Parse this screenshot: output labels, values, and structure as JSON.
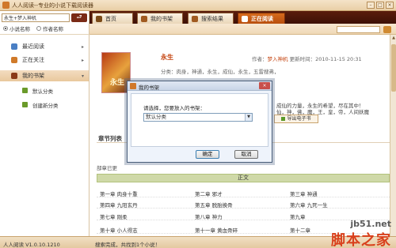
{
  "window": {
    "title": "人人阅读--专业的小说下载阅读器",
    "buttons": [
      "–",
      "□",
      "×"
    ]
  },
  "sidebar": {
    "search": {
      "value": "永生+梦入神机",
      "button": "⮐"
    },
    "radio": [
      {
        "label": "小说名称",
        "selected": true
      },
      {
        "label": "作者名称",
        "selected": false
      }
    ],
    "nav": [
      {
        "label": "最近阅读",
        "icon": "recent-icon",
        "color": "#4a7fc4"
      },
      {
        "label": "正在关注",
        "icon": "follow-icon",
        "color": "#d07a2a"
      },
      {
        "label": "我的书架",
        "icon": "bookshelf-icon",
        "color": "#8a3a18"
      }
    ],
    "sub": [
      {
        "label": "默认分类"
      },
      {
        "label": "创建新分类"
      }
    ]
  },
  "tabs": [
    {
      "label": "首页",
      "icon": "home-icon",
      "color": "#7a4a18"
    },
    {
      "label": "我的书架",
      "icon": "bookshelf-icon",
      "color": "#a05a20"
    },
    {
      "label": "搜索结果",
      "icon": "search-result-icon",
      "color": "#a05a20"
    },
    {
      "label": "正在阅读",
      "icon": "reading-icon",
      "color": "#ffffff"
    }
  ],
  "book": {
    "cover_text": "永生",
    "title": "永生",
    "meta_author_label": "作者：",
    "author": "梦入神机",
    "meta_update": "更新时间：2010-11-15 20:31",
    "tags": "分类：肉身，神通，永生，成仙，永生，五雷搜弗，",
    "desc_lines": [
      "成仙的力量，永生的希望，尽在其中！",
      "仙，神，佛，魔，王，皇，帝，人间妖魔"
    ],
    "export_label": "导出电子书"
  },
  "chapters": {
    "section_title": "章节列表",
    "notice": "部章已更",
    "volume": "正文",
    "rows": [
      [
        "第一章 肉身十重",
        "第二章 邪才",
        "第三章 神通"
      ],
      [
        "第四章 九阳玄丹",
        "第五章 脱胎换骨",
        "第六章 九死一生"
      ],
      [
        "第七章 刚柔",
        "第八章 神力",
        "第九章"
      ],
      [
        "第十章 小人得志",
        "第十一章 黄血骨碎",
        "第十二章"
      ]
    ]
  },
  "dialog": {
    "title": "我的书架",
    "prompt": "请选择，您要放入的书架：",
    "select_value": "默认分类",
    "ok": "确定",
    "cancel": "取消",
    "close": "×"
  },
  "status": {
    "version": "人人阅读 V1.0.10.1210",
    "message": "搜索完成，共找到1个小说！"
  },
  "watermark": {
    "url": "jb51.net",
    "cn": "脚本之家"
  }
}
